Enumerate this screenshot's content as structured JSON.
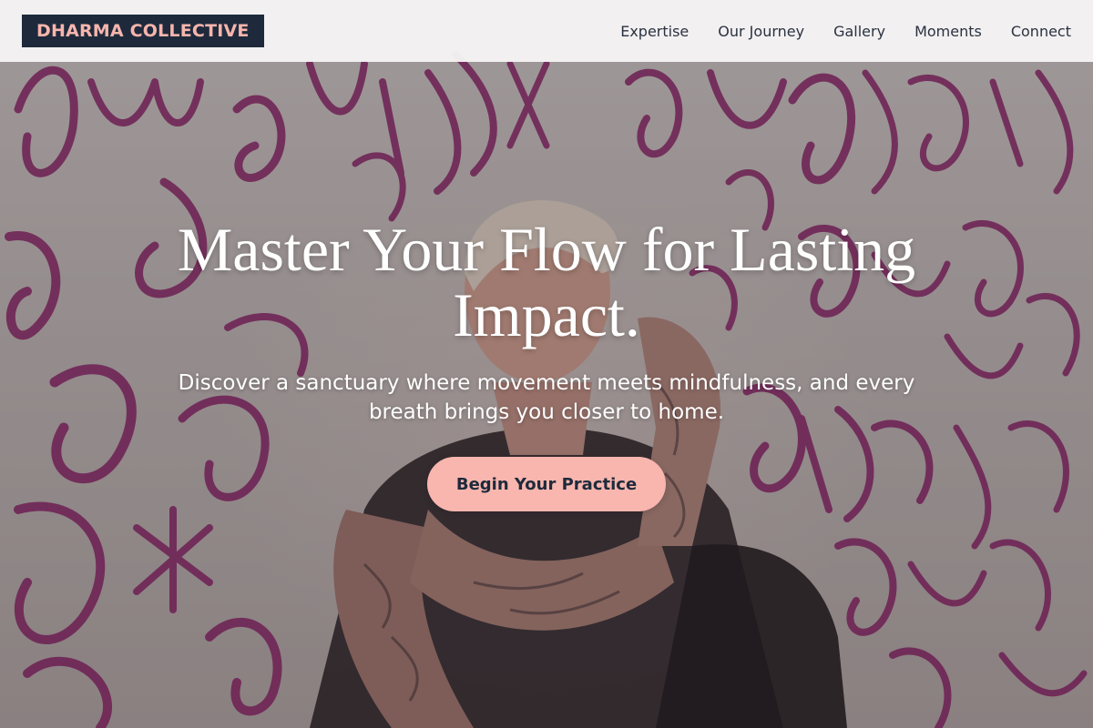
{
  "header": {
    "brand": "DHARMA COLLECTIVE",
    "nav": [
      {
        "label": "Expertise"
      },
      {
        "label": "Our Journey"
      },
      {
        "label": "Gallery"
      },
      {
        "label": "Moments"
      },
      {
        "label": "Connect"
      }
    ]
  },
  "hero": {
    "title": "Master Your Flow for Lasting Impact.",
    "subtitle": "Discover a sanctuary where movement meets mindfulness, and every breath brings you closer to home.",
    "cta_label": "Begin Your Practice"
  },
  "colors": {
    "brand_bg": "#1e2a3c",
    "brand_text": "#f7b5ad",
    "accent": "#f8b6ae",
    "graffiti": "#8e1f6a",
    "header_bg": "#f6f4f5"
  }
}
